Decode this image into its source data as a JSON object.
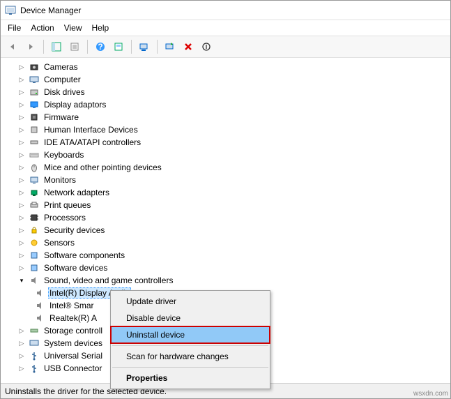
{
  "window": {
    "title": "Device Manager"
  },
  "menu": {
    "file": "File",
    "action": "Action",
    "view": "View",
    "help": "Help"
  },
  "tree": {
    "cameras": "Cameras",
    "computer": "Computer",
    "disk_drives": "Disk drives",
    "display_adaptors": "Display adaptors",
    "firmware": "Firmware",
    "hid": "Human Interface Devices",
    "ide": "IDE ATA/ATAPI controllers",
    "keyboards": "Keyboards",
    "mice": "Mice and other pointing devices",
    "monitors": "Monitors",
    "network": "Network adapters",
    "print_queues": "Print queues",
    "processors": "Processors",
    "security": "Security devices",
    "sensors": "Sensors",
    "sw_components": "Software components",
    "sw_devices": "Software devices",
    "sound": "Sound, video and game controllers",
    "intel_display_audio": "Intel(R) Display Audio",
    "intel_smart": "Intel® Smar",
    "realtek": "Realtek(R) A",
    "storage_controllers": "Storage controll",
    "system_devices": "System devices",
    "usb_serial": "Universal Serial",
    "usb_connector": "USB Connector"
  },
  "context_menu": {
    "update": "Update driver",
    "disable": "Disable device",
    "uninstall": "Uninstall device",
    "scan": "Scan for hardware changes",
    "properties": "Properties"
  },
  "status": "Uninstalls the driver for the selected device.",
  "watermark": "wsxdn.com"
}
